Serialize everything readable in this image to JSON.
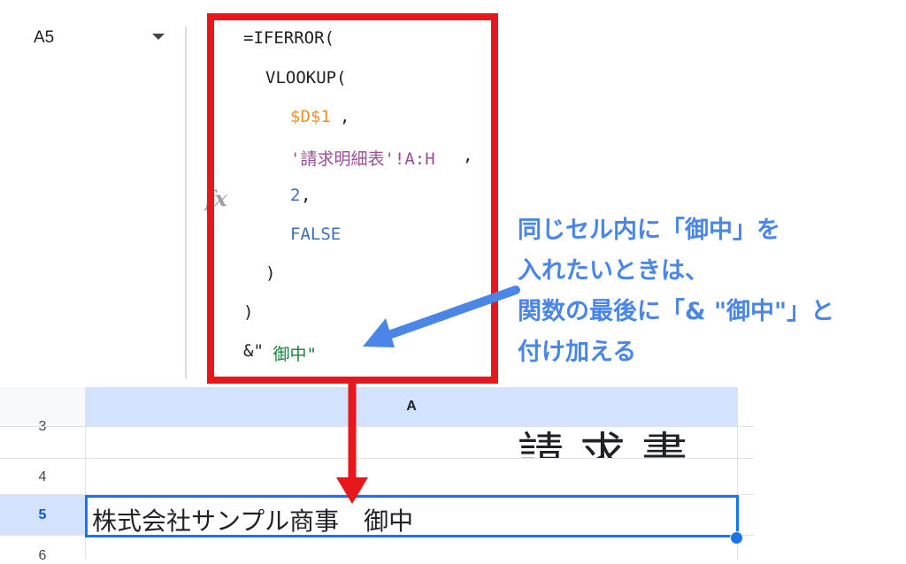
{
  "formula_bar": {
    "cell_reference": "A5",
    "fx_label": "fx",
    "lines": [
      {
        "text": "=IFERROR(",
        "color": "#202124"
      },
      {
        "text": "VLOOKUP(",
        "color": "#202124"
      },
      {
        "text": "$D$1",
        "color": "#e8922a",
        "suffix": ","
      },
      {
        "text": "'請求明細表'!A:H",
        "color": "#9b4f96",
        "suffix": ","
      },
      {
        "text": "2",
        "color": "#3d6fb5",
        "suffix": ","
      },
      {
        "text": "FALSE",
        "color": "#3d6fb5"
      },
      {
        "text": ")",
        "color": "#202124"
      },
      {
        "text": ")",
        "color": "#202124"
      },
      {
        "text": "&\"",
        "color": "#202124",
        "tail": " 御中\"",
        "tail_color": "#188038"
      }
    ]
  },
  "annotation": {
    "lines": [
      "同じセル内に「御中」を",
      "入れたいときは、",
      "関数の最後に「& \"御中\"」と",
      "付け加える"
    ],
    "color": "#4a86e8"
  },
  "sheet": {
    "column_header": "A",
    "row_numbers": [
      "3",
      "4",
      "5",
      "6"
    ],
    "row3_text": "請求書",
    "active_cell_value": "株式会社サンプル商事　御中"
  },
  "colors": {
    "highlight_box": "#e8171b",
    "selection": "#1a73e8",
    "header_selected": "#d3e3fd"
  }
}
